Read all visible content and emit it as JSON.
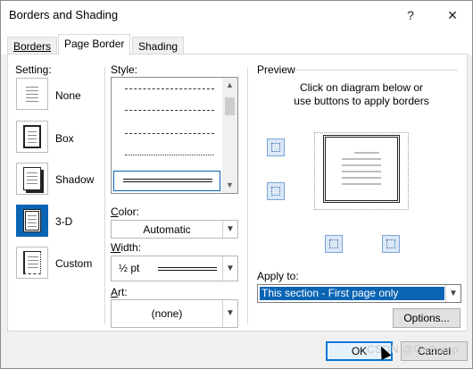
{
  "window": {
    "title": "Borders and Shading",
    "help_label": "?",
    "close_label": "✕"
  },
  "tabs": [
    {
      "label": "Borders",
      "active": false
    },
    {
      "label": "Page Border",
      "active": true
    },
    {
      "label": "Shading",
      "active": false
    }
  ],
  "setting": {
    "label": "Setting:",
    "options": [
      {
        "label": "None",
        "icon": "none-border-icon",
        "selected": false
      },
      {
        "label": "Box",
        "icon": "box-border-icon",
        "selected": false
      },
      {
        "label": "Shadow",
        "icon": "shadow-border-icon",
        "selected": false
      },
      {
        "label": "3-D",
        "icon": "3d-border-icon",
        "selected": true
      },
      {
        "label": "Custom",
        "icon": "custom-border-icon",
        "selected": false
      }
    ]
  },
  "style": {
    "label": "Style:"
  },
  "color": {
    "label": "Color:",
    "value": "Automatic"
  },
  "width": {
    "label": "Width:",
    "value": "½ pt"
  },
  "art": {
    "label": "Art:",
    "value": "(none)"
  },
  "preview": {
    "label": "Preview",
    "hint_line1": "Click on diagram below or",
    "hint_line2": "use buttons to apply borders"
  },
  "apply_to": {
    "label": "Apply to:",
    "value": "This section - First page only"
  },
  "buttons": {
    "options": "Options...",
    "ok": "OK",
    "cancel": "Cancel"
  },
  "watermark": "CSDN @GoSump",
  "colors": {
    "accent": "#0a64b4",
    "dialog_bg": "#f0f0f0"
  }
}
